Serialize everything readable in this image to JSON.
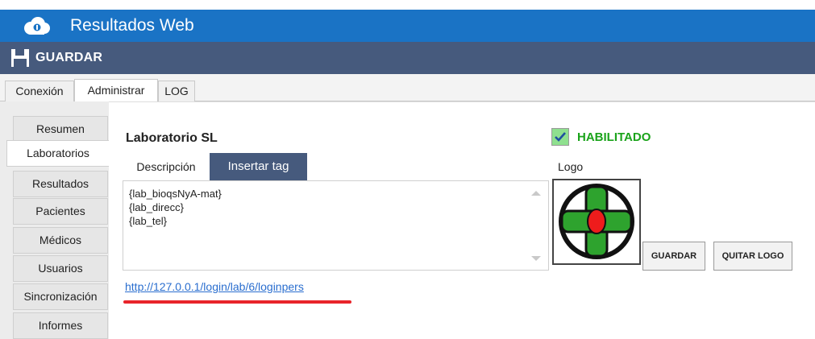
{
  "app": {
    "title": "Resultados Web"
  },
  "toolbar": {
    "save_label": "GUARDAR"
  },
  "tabs": [
    {
      "label": "Conexión",
      "active": false
    },
    {
      "label": "Administrar",
      "active": true
    },
    {
      "label": "LOG",
      "active": false
    }
  ],
  "sidebar": {
    "items": [
      {
        "label": "Resumen",
        "active": false
      },
      {
        "label": "Laboratorios",
        "active": true
      },
      {
        "label": "Resultados",
        "active": false
      },
      {
        "label": "Pacientes",
        "active": false
      },
      {
        "label": "Médicos",
        "active": false
      },
      {
        "label": "Usuarios",
        "active": false
      },
      {
        "label": "Sincronización",
        "active": false
      },
      {
        "label": "Informes",
        "active": false
      }
    ]
  },
  "lab": {
    "name": "Laboratorio SL",
    "enabled": true,
    "enabled_label": "HABILITADO",
    "desc_tab": "Descripción",
    "insert_tag": "Insertar tag",
    "description_lines": [
      "{lab_bioqsNyA-mat}",
      "{lab_direcc}",
      "{lab_tel}"
    ],
    "logo_label": "Logo",
    "logo_icon": "green-cross-logo-icon",
    "save_button": "GUARDAR",
    "remove_logo_button": "QUITAR LOGO",
    "url": "http://127.0.0.1/login/lab/6/loginpers"
  },
  "colors": {
    "titlebar": "#1a73c5",
    "toolbar": "#465a7d",
    "enabled_text": "#1aa31a",
    "link": "#2a6ecf",
    "annotation_underline": "#e8242a"
  }
}
